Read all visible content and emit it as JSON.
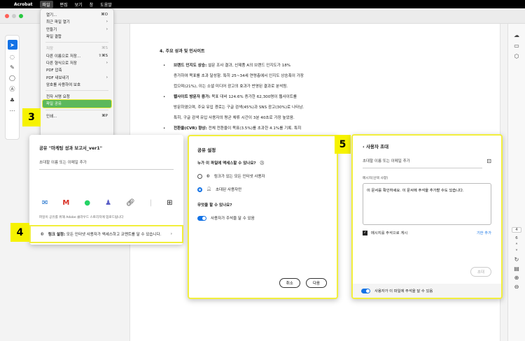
{
  "menubar": {
    "app": "Acrobat",
    "items": [
      "파일",
      "편집",
      "보기",
      "창",
      "도움말"
    ]
  },
  "file_menu": [
    {
      "label": "열기...",
      "shortcut": "⌘O"
    },
    {
      "label": "최근 파일 열기",
      "shortcut": "›"
    },
    {
      "label": "만들기",
      "shortcut": "›"
    },
    {
      "label": "파일 결합",
      "shortcut": ""
    },
    {
      "label": "저장",
      "shortcut": "⌘S",
      "disabled": true
    },
    {
      "label": "다른 이름으로 저장...",
      "shortcut": "⇧⌘S"
    },
    {
      "label": "다른 형식으로 저장",
      "shortcut": "›"
    },
    {
      "label": "PDF 압축",
      "shortcut": ""
    },
    {
      "label": "PDF 내보내기",
      "shortcut": "›"
    },
    {
      "label": "암호를 사용하여 보호",
      "shortcut": ""
    },
    {
      "label": "전자 서명 요청",
      "shortcut": ""
    },
    {
      "label": "파일 공유",
      "shortcut": ""
    },
    {
      "label": "인쇄...",
      "shortcut": "⌘P"
    }
  ],
  "steps": {
    "s3": "3",
    "s4": "4",
    "s5": "5"
  },
  "document": {
    "heading": "4. 주요 성과 및 인사이트",
    "bullets": [
      {
        "bold": "브랜드 인지도 상승:",
        "lines": [
          "설문 조사 결과, 신제품 A의 브랜드 인지도가 18%",
          "증가하여 목표를 초과 달성함. 특히 25~34세 연령층에서 인지도 상승폭이 가장",
          "컸으며(21%), 이는 소셜 미디어 광고의 효과가 반영된 결과로 분석됨."
        ]
      },
      {
        "bold": "웹사이트 방문자 증가:",
        "lines": [
          "목표 대비 124.6% 증가한 62,300명이 웹사이트를",
          "방문하였으며, 주요 유입 경로는 구글 검색(45%)과 SNS 광고(30%)로 나타남.",
          "특히, 구글 검색 유입 사용자의 평균 체류 시간이 3분 40초로 가장 높았음."
        ]
      },
      {
        "bold": "전환율(CVR) 향상:",
        "lines": [
          "전체 전환율이 목표(3.5%)를 초과한 4.1%를 기록. 특히"
        ]
      }
    ]
  },
  "share_dialog": {
    "title": "공유 \"마케팅 성과 보고서_ver1\"",
    "placeholder": "초대할 이름 또는 이메일 추가",
    "note": "파일이 공유를 위해 Adobe 클라우드 스토리지에 업로드됩니다",
    "link_label": "링크 설정:",
    "link_text": "모든 인터넷 사용자가 액세스하고 코멘트를 달 수 있습니다."
  },
  "share_settings": {
    "title": "공유 설정",
    "access_question": "누가 이 파일에 액세스할 수 있나요?",
    "option_anyone": "링크가 있는 모든 인터넷 사용자",
    "option_invited": "초대된 사용자만",
    "action_question": "무엇을 할 수 있나요?",
    "comment_toggle": "사용자가 주석을 달 수 있음",
    "cancel": "취소",
    "next": "다음"
  },
  "invite": {
    "back": "‹",
    "title": "사용자 초대",
    "placeholder": "초대할 이름 또는 이메일 추가",
    "message_label": "메시지(선택 사항)",
    "message": "이 문서를 확인하세요. 이 문서에 주석을 추가할 수도 있습니다.",
    "post_checkbox": "메시지를 주석으로 게시",
    "deadline": "기한 추가",
    "invite_button": "초대",
    "comment_toggle": "사용자가 이 파일에 주석을 달 수 있음"
  },
  "rail": {
    "page_current": "4",
    "page_total": "6"
  },
  "colors": {
    "accent": "#1473e6",
    "highlight": "#f6f200",
    "menu_highlight": "#5cb85c"
  }
}
